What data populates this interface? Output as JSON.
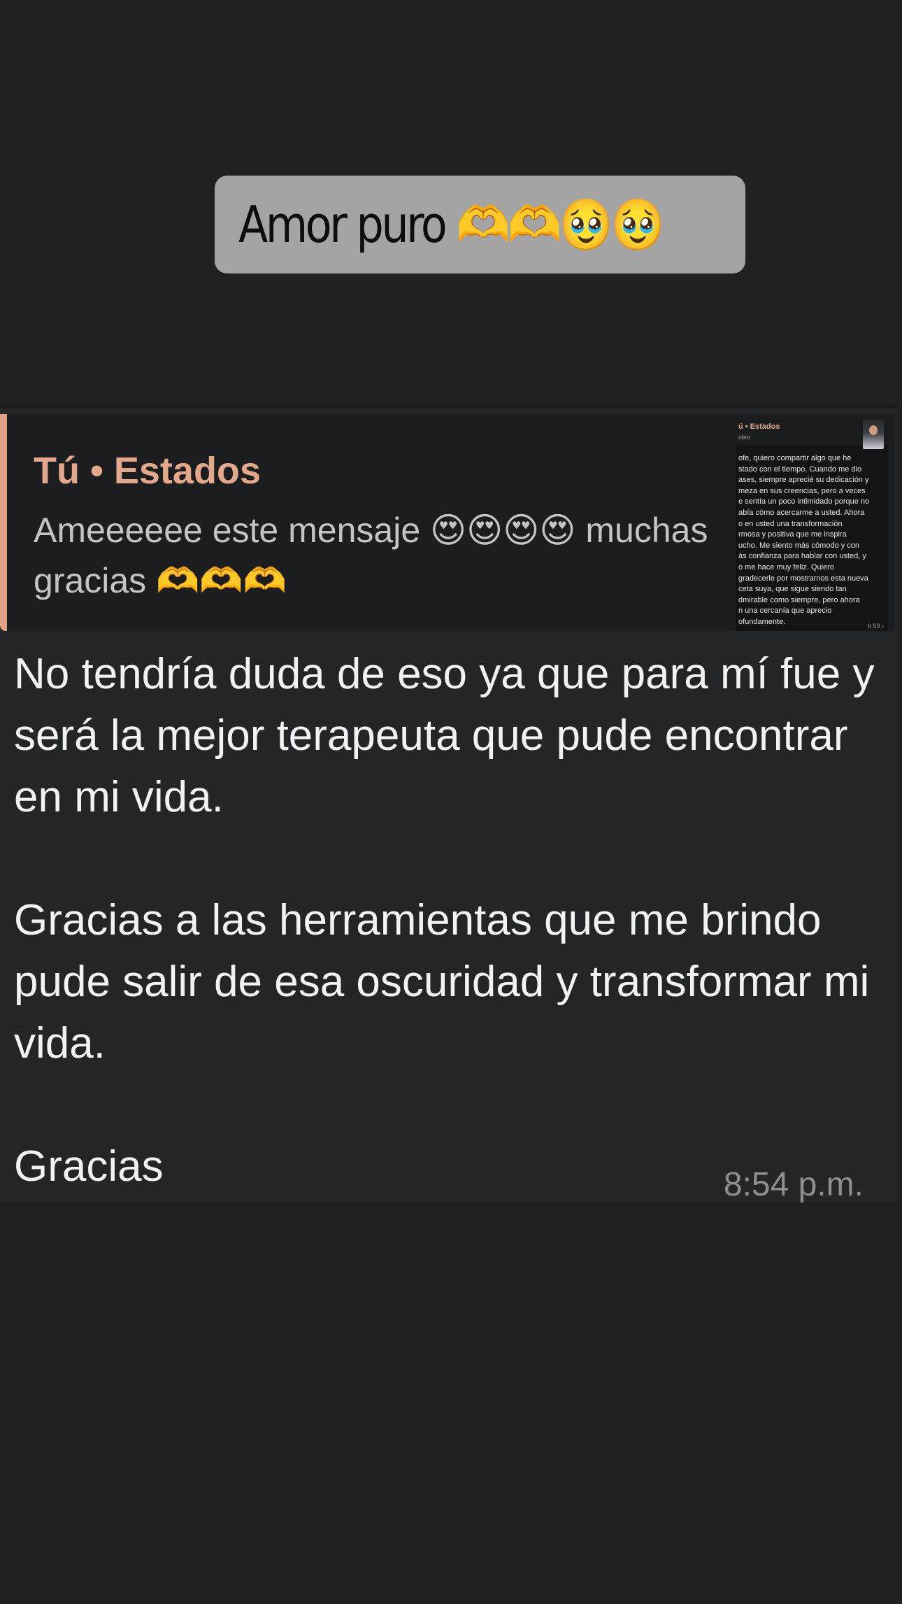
{
  "story": {
    "caption": "Amor puro 🫶🫶🥹🥹"
  },
  "chat": {
    "reply_quote": {
      "title": "Tú • Estados",
      "body": "Ameeeeee este mensaje 😍😍😍😍 muchas gracias 🫶🫶🫶",
      "accent_color": "#e0a184",
      "thumbnail": {
        "title": "ú • Estados",
        "subtitle": "ideo",
        "text": "ofe, quiero compartir algo que he\nstado con el tiempo. Cuando me dio\nases, siempre aprecié su dedicación y\nmeza en sus creencias, pero a veces\ne sentía un poco intimidado porque no\nabía cómo acercarme a usted. Ahora\no en usted una transformación\nrmosa y positiva que me inspira\nucho. Me siento más cómodo y con\nás confianza para hablar con usted, y\no me hace muy feliz. Quiero\ngradecerle por mostrarnos esta nueva\nceta suya, que sigue siendo tan\ndmirable como siempre, pero ahora\nn una cercanía que aprecio\nofundamente.",
        "time": "6:59 ›"
      }
    },
    "message": "No tendría duda de eso ya que para mí fue y será la mejor terapeuta que pude encontrar en mi vida.\n\nGracias a las herramientas que me brindo pude salir de esa oscuridad y transformar mi vida.\n\nGracias",
    "timestamp": "8:54 p.m."
  },
  "colors": {
    "background": "#202123",
    "bubble": "#242527",
    "caption_bg": "#a4a4a4",
    "quote_title": "#e3a88c"
  }
}
